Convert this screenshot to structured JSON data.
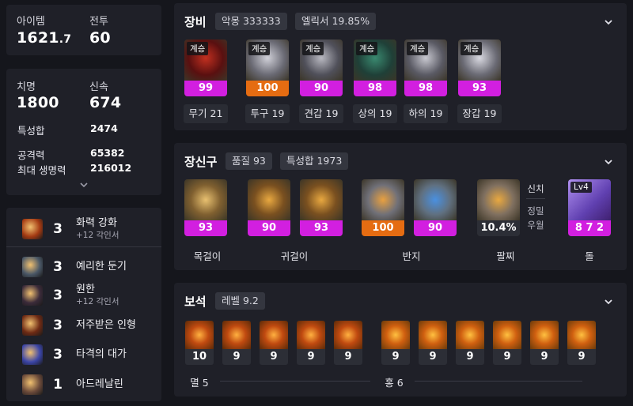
{
  "summary": {
    "item_label": "아이템",
    "item_value": "1621",
    "item_value_decimal": ".7",
    "transcend_label": "전투",
    "transcend_value": "60"
  },
  "stats": {
    "crit_label": "치명",
    "crit_value": "1800",
    "swift_label": "신속",
    "swift_value": "674",
    "total_label": "특성합",
    "total_value": "2474",
    "atk_label": "공격력",
    "atk_value": "65382",
    "hp_label": "최대 생명력",
    "hp_value": "216012"
  },
  "engravings": [
    {
      "level": "3",
      "name": "화력 강화",
      "sub": "+12 각인서",
      "icon": "fire-icon"
    },
    {
      "level": "3",
      "name": "예리한 둔기",
      "sub": "",
      "icon": "blunt-icon"
    },
    {
      "level": "3",
      "name": "원한",
      "sub": "+12 각인서",
      "icon": "grudge-icon"
    },
    {
      "level": "3",
      "name": "저주받은 인형",
      "sub": "",
      "icon": "doll-icon"
    },
    {
      "level": "3",
      "name": "타격의 대가",
      "sub": "",
      "icon": "strike-icon"
    },
    {
      "level": "1",
      "name": "아드레날린",
      "sub": "",
      "icon": "adrenaline-icon"
    }
  ],
  "equipment": {
    "title": "장비",
    "chip1": "악몽 333333",
    "chip2": "엘릭서 19.85%",
    "items": [
      {
        "tag": "계승",
        "quality": "99",
        "caption": "무기 21",
        "color": "#d21fe0"
      },
      {
        "tag": "계승",
        "quality": "100",
        "caption": "투구 19",
        "color": "#e56c12"
      },
      {
        "tag": "계승",
        "quality": "90",
        "caption": "견갑 19",
        "color": "#d21fe0"
      },
      {
        "tag": "계승",
        "quality": "98",
        "caption": "상의 19",
        "color": "#d21fe0"
      },
      {
        "tag": "계승",
        "quality": "98",
        "caption": "하의 19",
        "color": "#d21fe0"
      },
      {
        "tag": "계승",
        "quality": "93",
        "caption": "장갑 19",
        "color": "#d21fe0"
      }
    ]
  },
  "accessories": {
    "title": "장신구",
    "chip1": "품질 93",
    "chip2": "특성합 1973",
    "items": [
      {
        "quality": "93",
        "color": "#d21fe0"
      },
      {
        "quality": "90",
        "color": "#d21fe0"
      },
      {
        "quality": "93",
        "color": "#d21fe0"
      },
      {
        "quality": "100",
        "color": "#e56c12"
      },
      {
        "quality": "90",
        "color": "#d21fe0"
      },
      {
        "quality": "10.4%",
        "color": "#2c2e36"
      },
      {
        "quality": "8 7 2",
        "color": "#d21fe0",
        "tag": "Lv4"
      }
    ],
    "captions": [
      "목걸이",
      "귀걸이",
      "반지",
      "팔찌",
      "돌"
    ],
    "bracelet_side": [
      "신치",
      "정밀",
      "우월"
    ]
  },
  "gems": {
    "title": "보석",
    "chip1": "레벨 9.2",
    "left_values": [
      "10",
      "9",
      "9",
      "9",
      "9"
    ],
    "right_values": [
      "9",
      "9",
      "9",
      "9",
      "9",
      "9"
    ],
    "left_caption": "멸 5",
    "right_caption": "홍 6"
  }
}
